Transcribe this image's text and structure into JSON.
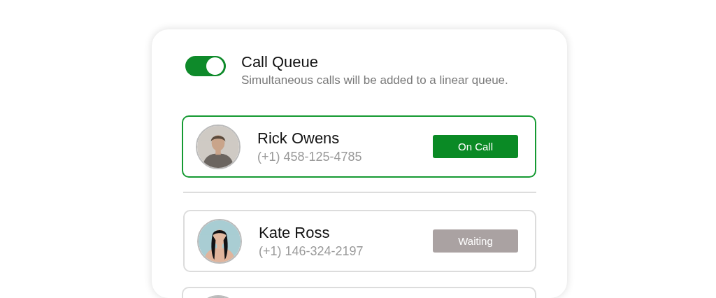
{
  "queue_setting": {
    "title": "Call Queue",
    "description": "Simultaneous calls will be added to a linear queue.",
    "on": true
  },
  "callers": [
    {
      "name": "Rick Owens",
      "phone": "(+1) 458-125-4785",
      "active": true,
      "status": {
        "label": "On Call",
        "kind": "on_call"
      }
    },
    {
      "name": "Kate Ross",
      "phone": "(+1) 146-324-2197",
      "active": false,
      "status": {
        "label": "Waiting",
        "kind": "waiting"
      }
    }
  ]
}
